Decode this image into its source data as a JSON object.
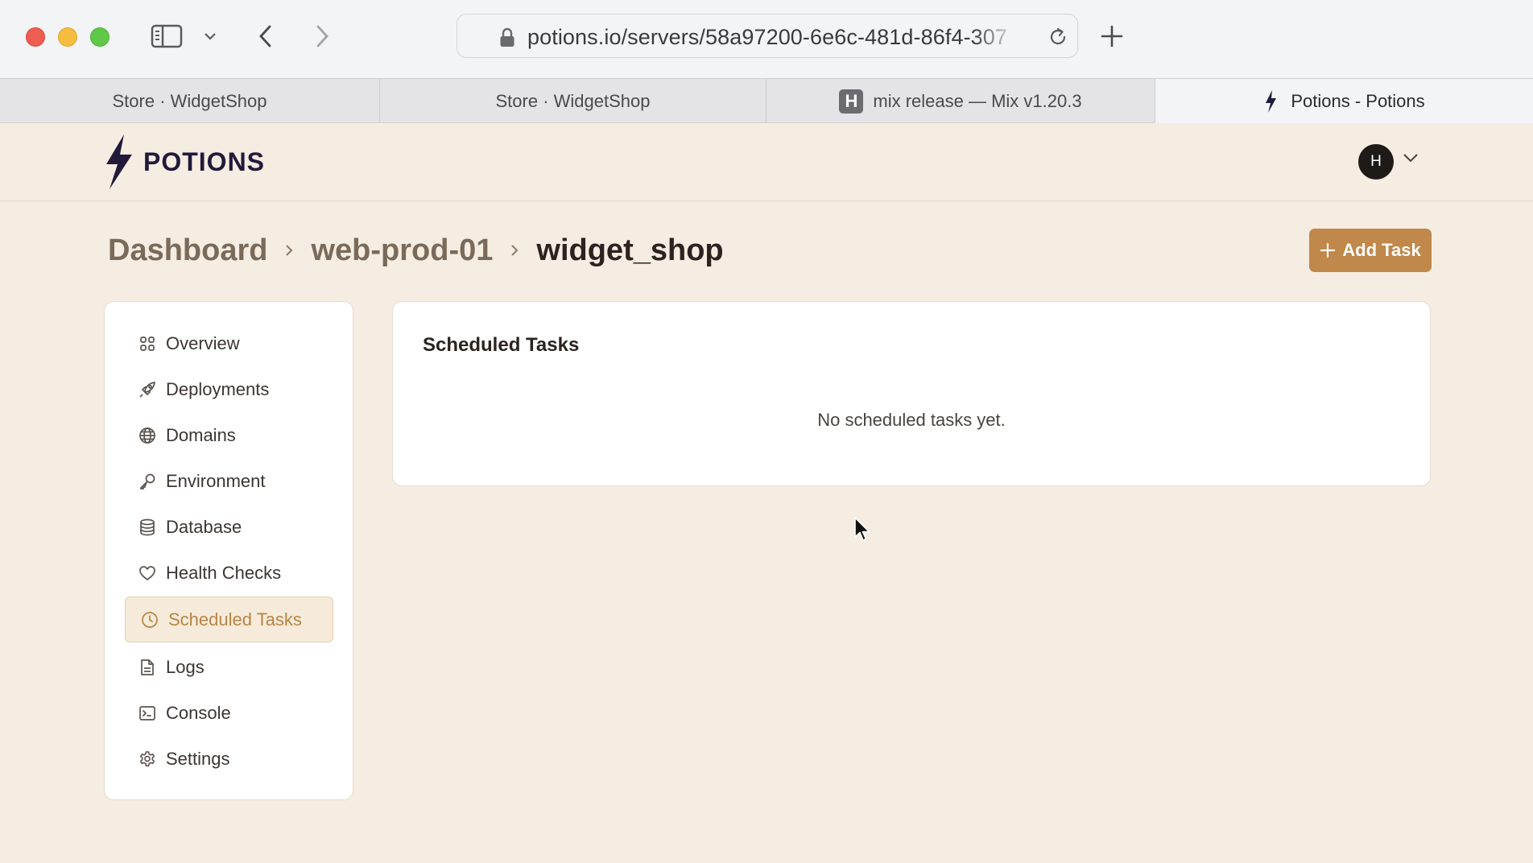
{
  "browser": {
    "url": "potions.io/servers/58a97200-6e6c-481d-86f4-307",
    "tabs": [
      {
        "label": "Store · WidgetShop",
        "favicon": "none",
        "active": false
      },
      {
        "label": "Store · WidgetShop",
        "favicon": "none",
        "active": false
      },
      {
        "label": "mix release — Mix v1.20.3",
        "favicon": "H",
        "active": false
      },
      {
        "label": "Potions - Potions",
        "favicon": "bolt-icon",
        "active": true
      }
    ]
  },
  "header": {
    "logo_text": "POTIONS",
    "avatar_initial": "H"
  },
  "breadcrumb": {
    "items": [
      "Dashboard",
      "web-prod-01",
      "widget_shop"
    ]
  },
  "actions": {
    "add_task_label": "Add Task"
  },
  "sidebar": {
    "items": [
      {
        "label": "Overview",
        "icon": "grid-icon"
      },
      {
        "label": "Deployments",
        "icon": "rocket-icon"
      },
      {
        "label": "Domains",
        "icon": "globe-icon"
      },
      {
        "label": "Environment",
        "icon": "key-icon"
      },
      {
        "label": "Database",
        "icon": "database-icon"
      },
      {
        "label": "Health Checks",
        "icon": "heart-icon"
      },
      {
        "label": "Scheduled Tasks",
        "icon": "clock-icon",
        "active": true
      },
      {
        "label": "Logs",
        "icon": "file-icon"
      },
      {
        "label": "Console",
        "icon": "terminal-icon"
      },
      {
        "label": "Settings",
        "icon": "gear-icon"
      }
    ]
  },
  "main": {
    "card_title": "Scheduled Tasks",
    "empty_message": "No scheduled tasks yet."
  },
  "colors": {
    "page_background": "#f5ede1",
    "accent": "#c0884a",
    "logo_dark": "#221a3a"
  }
}
